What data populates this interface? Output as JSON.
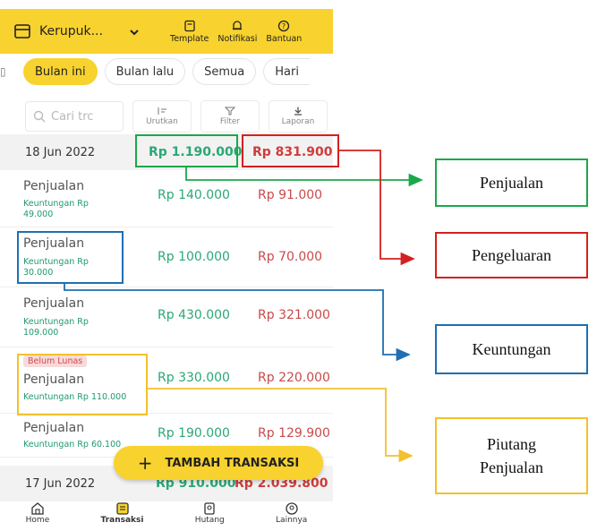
{
  "header": {
    "business_name": "Kerupuk...",
    "actions": [
      {
        "label": "Template",
        "icon": "template-icon"
      },
      {
        "label": "Notifikasi",
        "icon": "bell-icon"
      },
      {
        "label": "Bantuan",
        "icon": "help-icon"
      }
    ]
  },
  "filters": {
    "chips": [
      "Bulan ini",
      "Bulan lalu",
      "Semua",
      "Hari"
    ],
    "active": "Bulan ini"
  },
  "toolbar": {
    "search_placeholder": "Cari trc",
    "sort_label": "Urutkan",
    "filter_label": "Filter",
    "report_label": "Laporan"
  },
  "groups": [
    {
      "date": "18 Jun 2022",
      "total_in": "Rp 1.190.000",
      "total_out": "Rp 831.900",
      "transactions": [
        {
          "title": "Penjualan",
          "profit_line1": "Keuntungan Rp",
          "profit_line2": "49.000",
          "amount_in": "Rp 140.000",
          "amount_out": "Rp 91.000",
          "badge": ""
        },
        {
          "title": "Penjualan",
          "profit_line1": "Keuntungan Rp",
          "profit_line2": "30.000",
          "amount_in": "Rp 100.000",
          "amount_out": "Rp 70.000",
          "badge": ""
        },
        {
          "title": "Penjualan",
          "profit_line1": "Keuntungan Rp",
          "profit_line2": "109.000",
          "amount_in": "Rp 430.000",
          "amount_out": "Rp 321.000",
          "badge": ""
        },
        {
          "title": "Penjualan",
          "profit_line1": "Keuntungan Rp 110.000",
          "profit_line2": "",
          "amount_in": "Rp 330.000",
          "amount_out": "Rp 220.000",
          "badge": "Belum Lunas"
        },
        {
          "title": "Penjualan",
          "profit_line1": "Keuntungan Rp 60.100",
          "profit_line2": "",
          "amount_in": "Rp 190.000",
          "amount_out": "Rp 129.900",
          "badge": ""
        }
      ]
    },
    {
      "date": "17 Jun 2022",
      "total_in": "Rp 910.000",
      "total_out": "Rp 2.039.800",
      "transactions": []
    }
  ],
  "fab": {
    "label": "TAMBAH TRANSAKSI"
  },
  "bottom_nav": [
    "Home",
    "Transaksi",
    "Hutang",
    "Lainnya"
  ],
  "annotations": {
    "penjualan": "Penjualan",
    "pengeluaran": "Pengeluaran",
    "keuntungan": "Keuntungan",
    "piutang_line1": "Piutang",
    "piutang_line2": "Penjualan"
  },
  "colors": {
    "brand_yellow": "#f8d22e",
    "income_green": "#2aa876",
    "expense_red": "#cf3c3c",
    "annot_green": "#1aa84a",
    "annot_red": "#d42020",
    "annot_blue": "#1f6fb2",
    "annot_yellow": "#f2c12e"
  }
}
